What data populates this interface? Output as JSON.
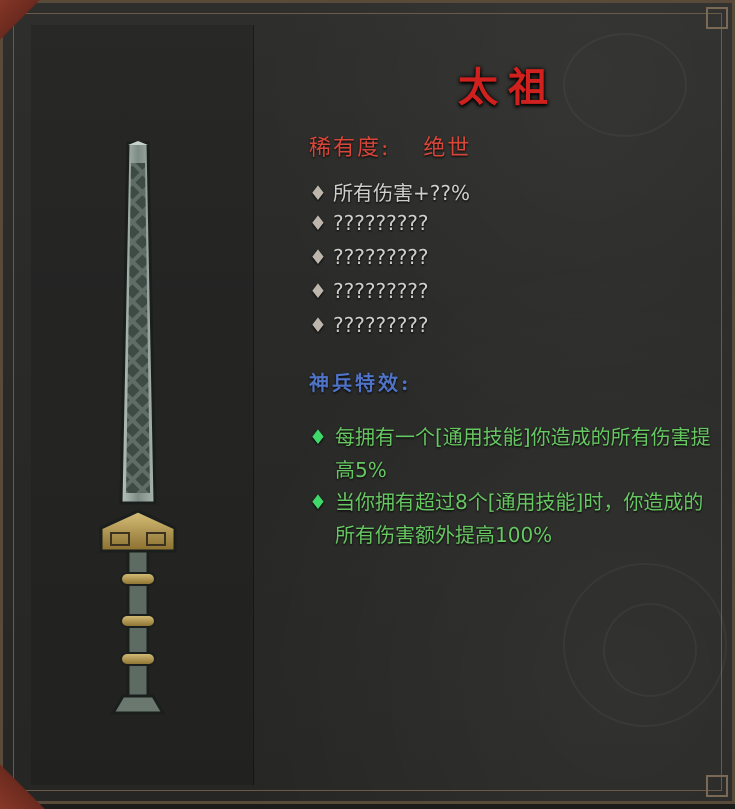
{
  "item": {
    "name": "太祖",
    "rarity_label": "稀有度:",
    "rarity_value": "绝世"
  },
  "stats": [
    {
      "icon": "diamond-icon",
      "text": "所有伤害+??%"
    },
    {
      "icon": "diamond-icon",
      "text": "?????????"
    },
    {
      "icon": "diamond-icon",
      "text": "?????????"
    },
    {
      "icon": "diamond-icon",
      "text": "?????????"
    },
    {
      "icon": "diamond-icon",
      "text": "?????????"
    }
  ],
  "effects_title": "神兵特效:",
  "effects": [
    {
      "icon": "diamond-icon",
      "text": "每拥有一个[通用技能]你造成的所有伤害提高5%"
    },
    {
      "icon": "diamond-icon",
      "text": "当你拥有超过8个[通用技能]时，你造成的所有伤害额外提高100%"
    }
  ],
  "colors": {
    "title": "#d0211e",
    "rarity": "#d8463a",
    "effects_title": "#4f73c6",
    "effects": "#67c763",
    "stats": "#cfcfcf"
  }
}
